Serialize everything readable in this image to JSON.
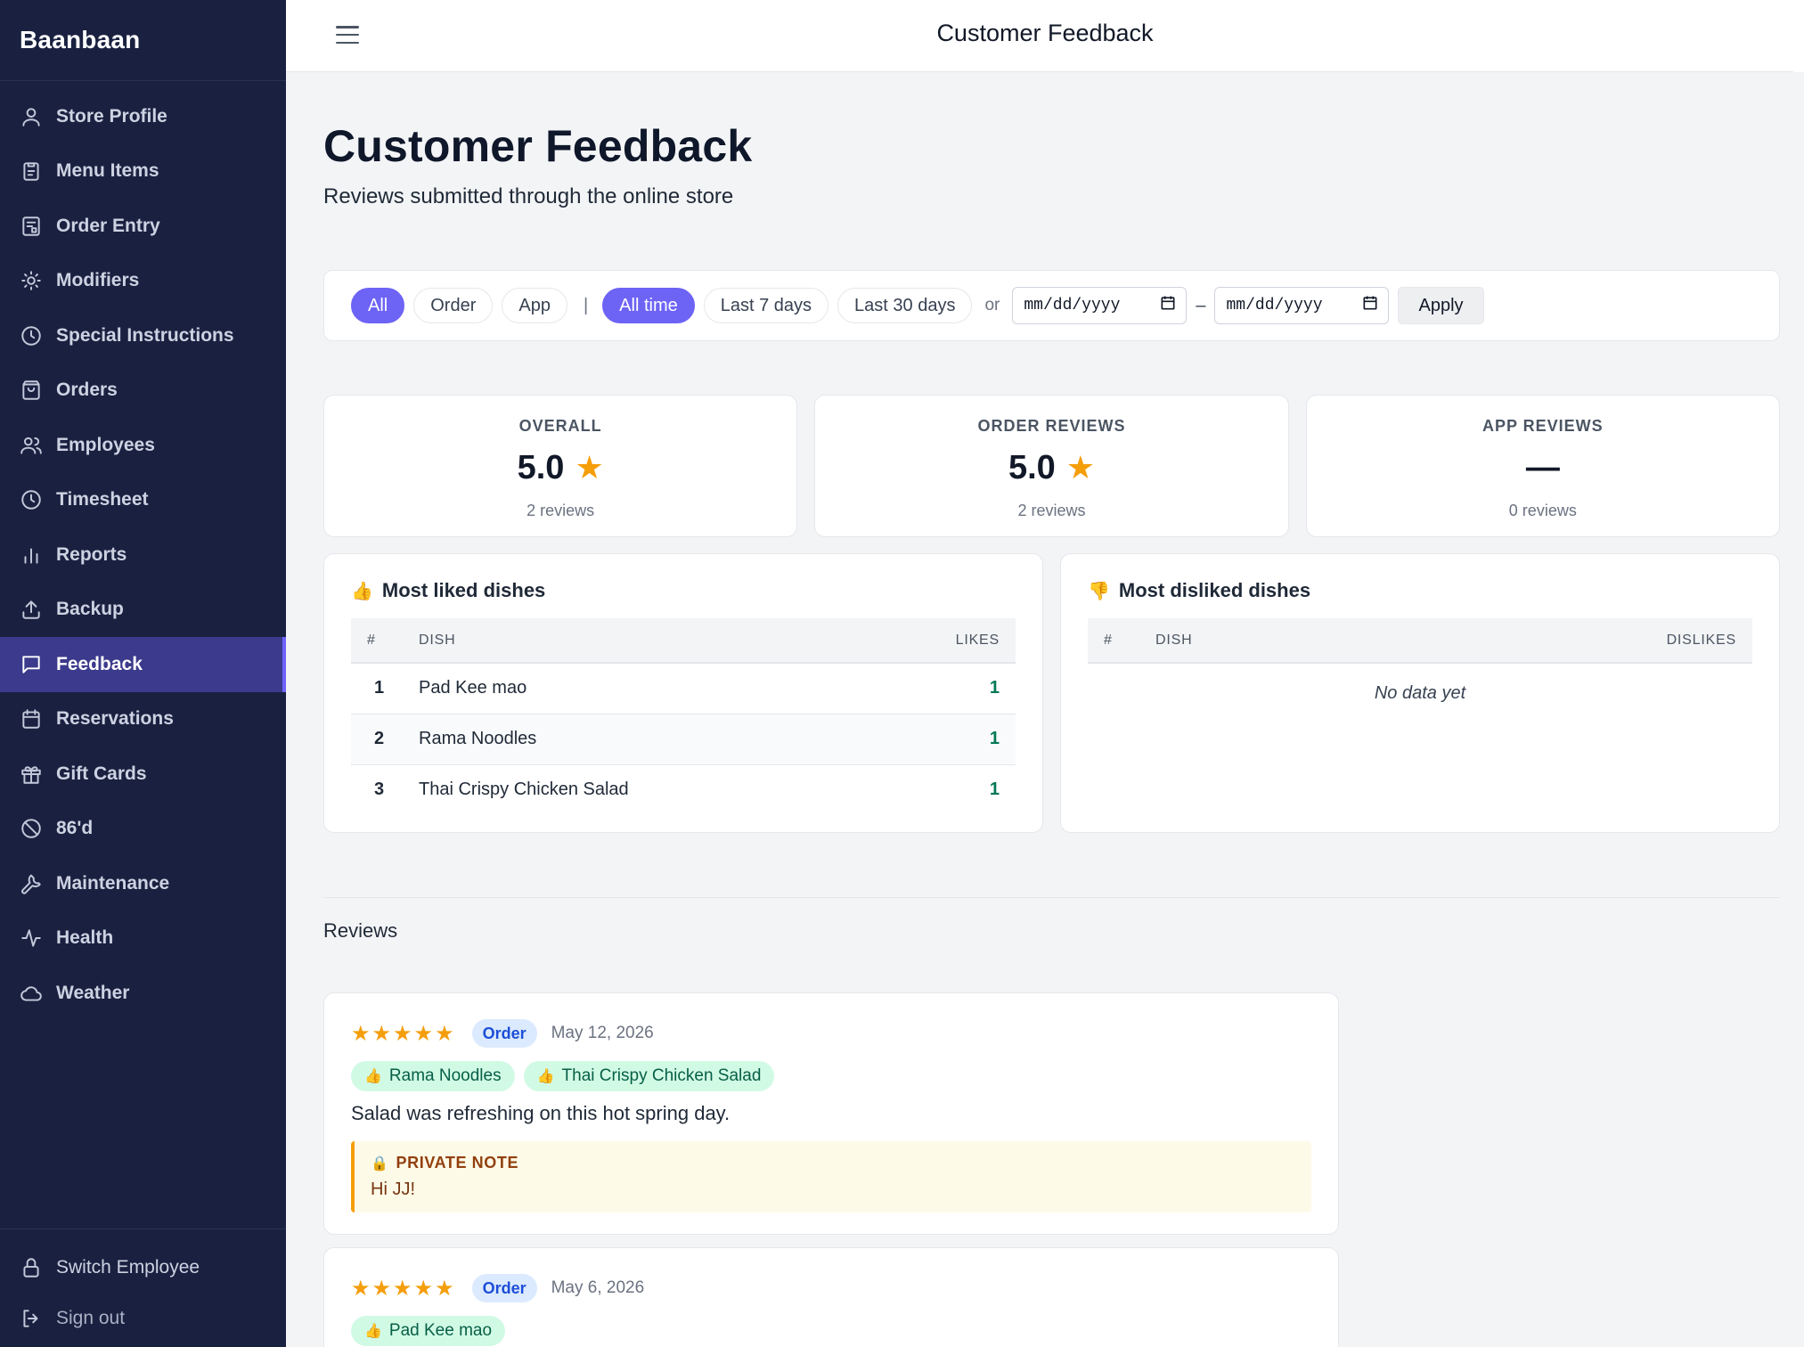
{
  "brand": "Baanbaan",
  "sidebar": {
    "items": [
      {
        "label": "Store Profile",
        "icon": "user-icon"
      },
      {
        "label": "Menu Items",
        "icon": "clipboard-icon"
      },
      {
        "label": "Order Entry",
        "icon": "order-entry-icon"
      },
      {
        "label": "Modifiers",
        "icon": "sun-icon"
      },
      {
        "label": "Special Instructions",
        "icon": "clock-icon"
      },
      {
        "label": "Orders",
        "icon": "shopping-bag-icon"
      },
      {
        "label": "Employees",
        "icon": "users-icon"
      },
      {
        "label": "Timesheet",
        "icon": "clock-icon"
      },
      {
        "label": "Reports",
        "icon": "bar-chart-icon"
      },
      {
        "label": "Backup",
        "icon": "upload-icon"
      },
      {
        "label": "Feedback",
        "icon": "message-square-icon",
        "active": true
      },
      {
        "label": "Reservations",
        "icon": "calendar-icon"
      },
      {
        "label": "Gift Cards",
        "icon": "gift-icon"
      },
      {
        "label": "86'd",
        "icon": "ban-icon"
      },
      {
        "label": "Maintenance",
        "icon": "wrench-icon"
      },
      {
        "label": "Health",
        "icon": "activity-icon"
      },
      {
        "label": "Weather",
        "icon": "cloud-icon"
      }
    ],
    "bottom": [
      {
        "label": "Switch Employee",
        "icon": "lock-icon"
      },
      {
        "label": "Sign out",
        "icon": "sign-out-icon"
      }
    ]
  },
  "topbar": {
    "title": "Customer Feedback"
  },
  "page": {
    "title": "Customer Feedback",
    "subtitle": "Reviews submitted through the online store"
  },
  "filters": {
    "source": [
      {
        "label": "All",
        "active": true
      },
      {
        "label": "Order",
        "active": false
      },
      {
        "label": "App",
        "active": false
      }
    ],
    "separator": "|",
    "range": [
      {
        "label": "All time",
        "active": true
      },
      {
        "label": "Last 7 days",
        "active": false
      },
      {
        "label": "Last 30 days",
        "active": false
      }
    ],
    "or_label": "or",
    "date_from": "mm/dd/yyyy",
    "date_to": "mm/dd/yyyy",
    "dash": "–",
    "apply_label": "Apply"
  },
  "stats": [
    {
      "label": "OVERALL",
      "value": "5.0",
      "star": "★",
      "count": "2 reviews"
    },
    {
      "label": "ORDER REVIEWS",
      "value": "5.0",
      "star": "★",
      "count": "2 reviews"
    },
    {
      "label": "APP REVIEWS",
      "value": "—",
      "star": "",
      "count": "0 reviews"
    }
  ],
  "liked": {
    "emoji": "👍",
    "title": "Most liked dishes",
    "columns": [
      "#",
      "DISH",
      "LIKES"
    ],
    "rows": [
      {
        "rank": "1",
        "dish": "Pad Kee mao",
        "count": "1"
      },
      {
        "rank": "2",
        "dish": "Rama Noodles",
        "count": "1"
      },
      {
        "rank": "3",
        "dish": "Thai Crispy Chicken Salad",
        "count": "1"
      }
    ]
  },
  "disliked": {
    "emoji": "👎",
    "title": "Most disliked dishes",
    "columns": [
      "#",
      "DISH",
      "DISLIKES"
    ],
    "empty": "No data yet"
  },
  "reviews": {
    "title": "Reviews",
    "items": [
      {
        "stars": "★★★★★",
        "rating": 5,
        "source": "Order",
        "date": "May 12, 2026",
        "chips": [
          {
            "emoji": "👍",
            "label": "Rama Noodles"
          },
          {
            "emoji": "👍",
            "label": "Thai Crispy Chicken Salad"
          }
        ],
        "text": "Salad was refreshing on this hot spring day.",
        "note_emoji": "🔒",
        "note_label": "PRIVATE NOTE",
        "note_text": "Hi JJ!"
      },
      {
        "stars": "★★★★★",
        "rating": 5,
        "source": "Order",
        "date": "May 6, 2026",
        "chips": [
          {
            "emoji": "👍",
            "label": "Pad Kee mao"
          }
        ]
      }
    ]
  },
  "colors": {
    "sidebar_bg": "#1a2140",
    "accent": "#6d63f5",
    "active_nav": "#3b3a8c",
    "star": "#f59e0b",
    "like_green": "#047857"
  }
}
